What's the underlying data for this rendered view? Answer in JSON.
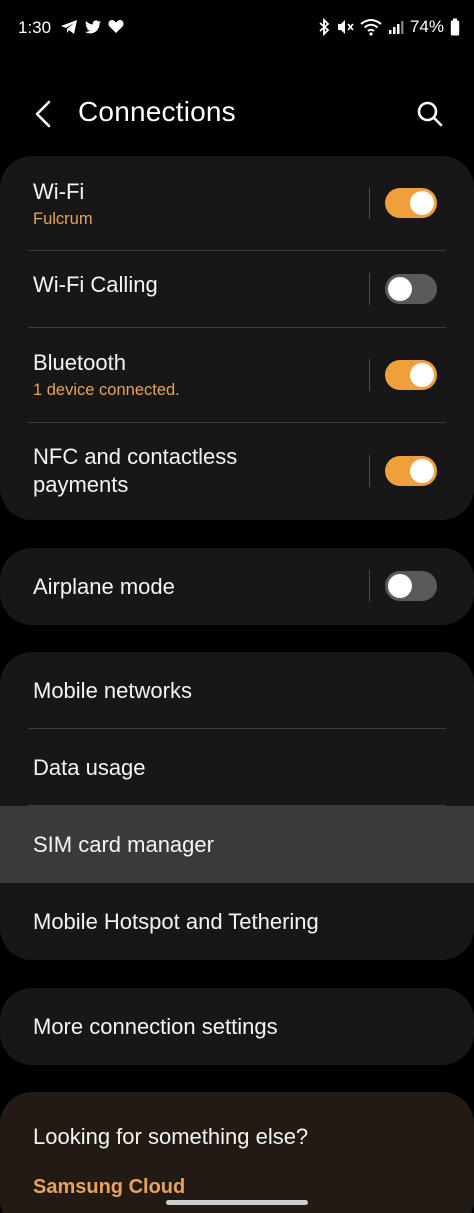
{
  "status_bar": {
    "time": "1:30",
    "battery": "74%",
    "left_icons": [
      "telegram-icon",
      "twitter-icon",
      "heart-icon"
    ],
    "right_icons": [
      "bluetooth-icon",
      "mute-icon",
      "wifi-icon",
      "signal-icon",
      "battery-icon"
    ]
  },
  "header": {
    "title": "Connections",
    "back_icon": "back-arrow-icon",
    "search_icon": "search-icon"
  },
  "group1": [
    {
      "title": "Wi-Fi",
      "subtitle": "Fulcrum",
      "toggle": "on"
    },
    {
      "title": "Wi-Fi Calling",
      "toggle": "off"
    },
    {
      "title": "Bluetooth",
      "subtitle": "1 device connected.",
      "toggle": "on"
    },
    {
      "title": "NFC and contactless payments",
      "title_line1": "NFC and contactless",
      "title_line2": "payments",
      "toggle": "on"
    }
  ],
  "group2": [
    {
      "title": "Airplane mode",
      "toggle": "off"
    }
  ],
  "group3": [
    {
      "title": "Mobile networks"
    },
    {
      "title": "Data usage"
    },
    {
      "title": "SIM card manager",
      "pressed": true
    },
    {
      "title": "Mobile Hotspot and Tethering"
    }
  ],
  "group4": [
    {
      "title": "More connection settings"
    }
  ],
  "suggestions": {
    "title": "Looking for something else?",
    "link": "Samsung Cloud"
  },
  "colors": {
    "accent": "#f0a03a",
    "subtitle": "#e8a25a",
    "card_bg": "#171717",
    "page_bg": "#000000"
  }
}
